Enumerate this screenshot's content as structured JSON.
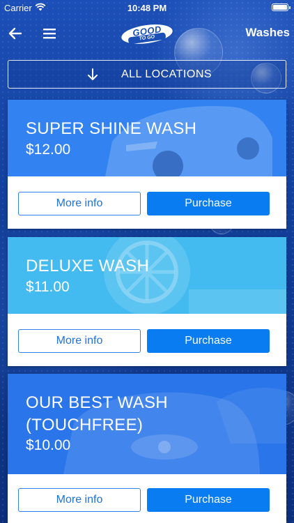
{
  "status_bar": {
    "carrier": "Carrier",
    "time": "10:48 PM"
  },
  "nav": {
    "logo_top": "GOOD",
    "logo_bottom": "TO GO",
    "title": "Washes",
    "back_icon": "arrow-left-icon",
    "menu_icon": "hamburger-menu-icon"
  },
  "location": {
    "label": "ALL LOCATIONS",
    "icon": "arrow-down-icon"
  },
  "washes": [
    {
      "title_lines": [
        "SUPER SHINE WASH"
      ],
      "price": "$12.00",
      "more_label": "More info",
      "purchase_label": "Purchase",
      "tint": "#2a7af0"
    },
    {
      "title_lines": [
        "DELUXE WASH"
      ],
      "price": "$11.00",
      "more_label": "More info",
      "purchase_label": "Purchase",
      "tint": "#3fb6ee"
    },
    {
      "title_lines": [
        "OUR BEST WASH",
        "(TOUCHFREE)"
      ],
      "price": "$10.00",
      "more_label": "More info",
      "purchase_label": "Purchase",
      "tint": "#2570e6"
    }
  ],
  "colors": {
    "accent": "#0a7cf2",
    "outline": "#2f80ed",
    "background": "#123f9a"
  }
}
